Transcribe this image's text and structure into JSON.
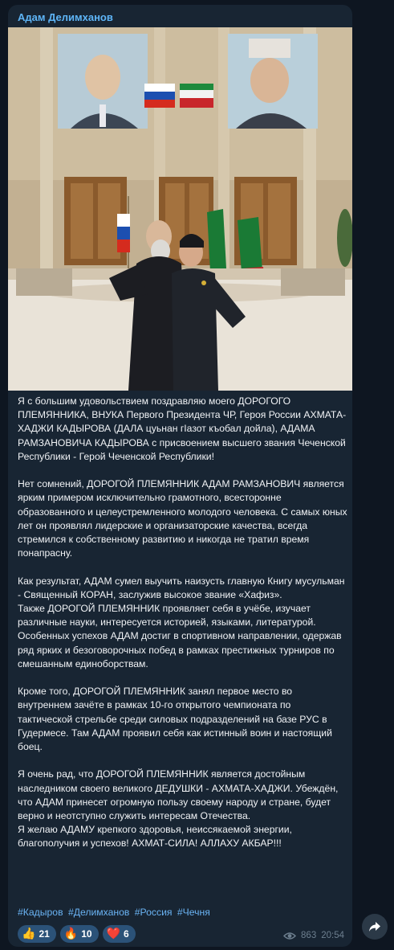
{
  "post": {
    "author": "Адам Делимханов",
    "photo_icon": "photo-of-two-men-in-ceremonial-hall",
    "paragraphs": [
      "Я с большим удовольствием поздравляю моего ДОРОГОГО ПЛЕМЯННИКА, ВНУКА Первого Президента ЧР, Героя России АХМАТА-ХАДЖИ КАДЫРОВА (ДАЛА цуьнан гIазот къобал дойла), АДАМА РАМЗАНОВИЧА КАДЫРОВА с присвоением высшего звания Чеченской Республики - Герой Чеченской Республики!",
      "Нет сомнений, ДОРОГОЙ ПЛЕМЯННИК АДАМ РАМЗАНОВИЧ является ярким примером исключительно грамотного, всесторонне образованного и целеустремленного молодого человека. С самых юных лет он проявлял лидерские и организаторские качества, всегда стремился к собственному развитию и никогда не тратил время понапрасну.",
      "Как результат, АДАМ сумел выучить наизусть главную Книгу мусульман - Священный КОРАН, заслужив высокое звание «Хафиз».",
      "Также ДОРОГОЙ ПЛЕМЯННИК проявляет себя в учёбе, изучает различные науки, интересуется историей, языками, литературой. Особенных успехов АДАМ достиг в спортивном направлении, одержав ряд ярких и безоговорочных побед в рамках престижных турниров по смешанным единоборствам.",
      "Кроме того,  ДОРОГОЙ ПЛЕМЯННИК занял первое место во внутреннем зачёте в рамках 10-го открытого чемпионата по тактической стрельбе среди силовых подразделений на базе РУС в Гудермесе. Там АДАМ проявил себя как истинный воин и настоящий боец.",
      "Я очень рад, что ДОРОГОЙ ПЛЕМЯННИК является достойным наследником своего великого ДЕДУШКИ - АХМАТА-ХАДЖИ. Убеждён, что АДАМ принесет огромную пользу своему народу и стране, будет верно и неотступно служить интересам Отечества.",
      "Я желаю АДАМУ крепкого здоровья, неиссякаемой энергии, благополучия и успехов! АХМАТ-СИЛА! АЛЛАХУ АКБАР!!!"
    ],
    "hashtags": [
      "#Кадыров",
      "#Делимханов",
      "#Россия",
      "#Чечня"
    ],
    "reactions": [
      {
        "emoji": "👍",
        "icon": "thumbs-up-icon",
        "count": "21"
      },
      {
        "emoji": "🔥",
        "icon": "fire-icon",
        "count": "10"
      },
      {
        "emoji": "❤️",
        "icon": "heart-icon",
        "count": "6"
      }
    ],
    "views": "863",
    "time": "20:54",
    "share_icon": "share-arrow-icon"
  },
  "colors": {
    "background": "#0e1621",
    "bubble": "#182533",
    "author": "#5eb5f7",
    "link": "#6ab3f3",
    "reaction": "#2b5278"
  }
}
